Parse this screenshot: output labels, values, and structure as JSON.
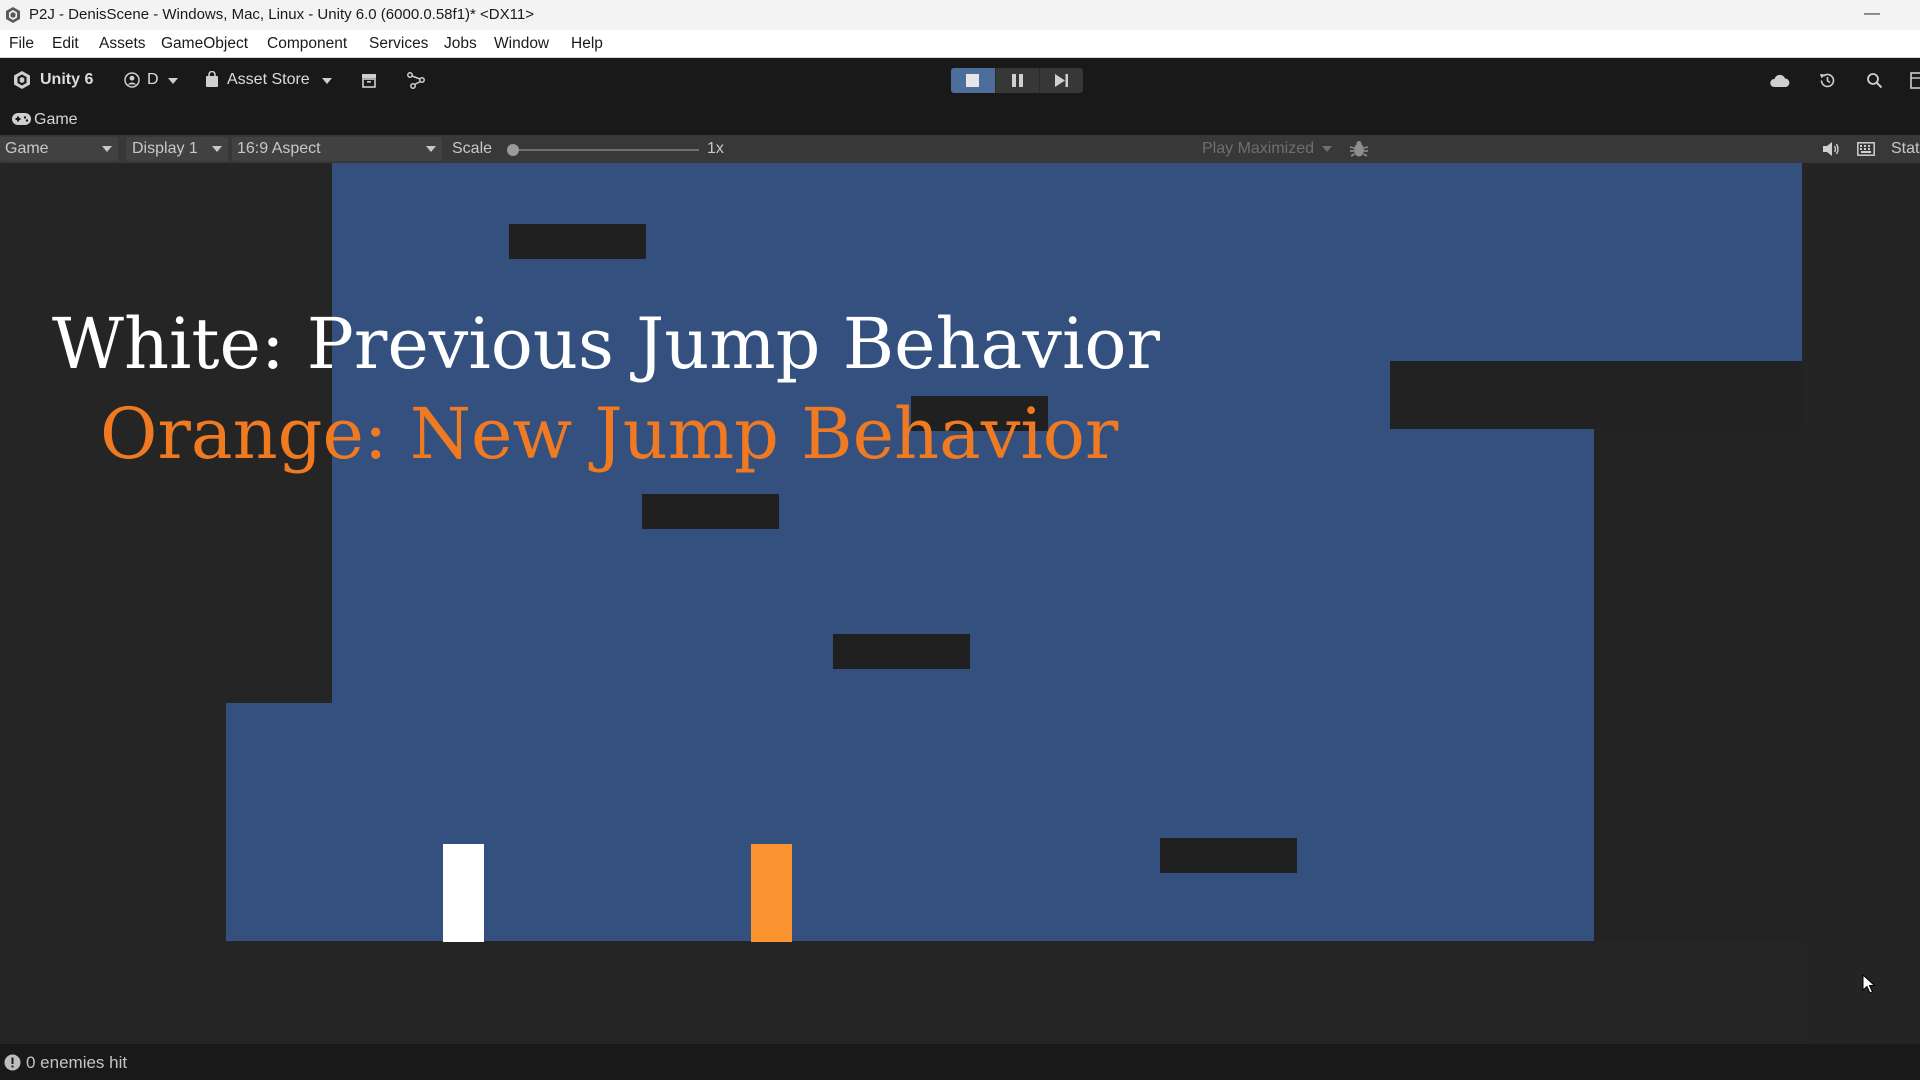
{
  "window": {
    "title": "P2J - DenisScene - Windows, Mac, Linux - Unity 6.0 (6000.0.58f1)* <DX11>",
    "minimize_glyph": "—"
  },
  "menu": [
    "File",
    "Edit",
    "Assets",
    "GameObject",
    "Component",
    "Services",
    "Jobs",
    "Window",
    "Help"
  ],
  "toolbar": {
    "unity_label": "Unity 6",
    "account_label": "D",
    "asset_store_label": "Asset Store"
  },
  "game_tab": {
    "label": "Game"
  },
  "game_toolbar": {
    "mode": "Game",
    "display": "Display 1",
    "aspect": "16:9 Aspect",
    "scale_label": "Scale",
    "scale_value": "1x",
    "scale_fraction": 0.0,
    "play_mode": "Play Maximized",
    "stats_label": "Stat"
  },
  "game": {
    "line1": "White: Previous Jump Behavior",
    "line2": "Orange: New Jump Behavior",
    "colors": {
      "sky": "#34507e",
      "platform": "#202020",
      "white_player": "#ffffff",
      "orange_player": "#fa9430",
      "orange_text": "#f07a21"
    }
  },
  "status": {
    "message": "0 enemies hit"
  },
  "colors": {
    "active_play": "#4d6e9a",
    "editor_dark": "#191919"
  }
}
